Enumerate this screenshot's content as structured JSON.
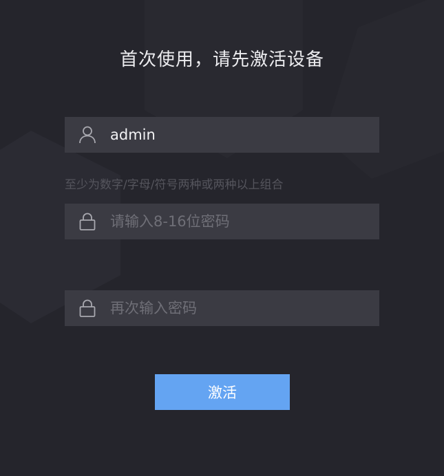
{
  "title": "首次使用，请先激活设备",
  "username": {
    "value": "admin",
    "icon": "user-icon"
  },
  "password_hint": "至少为数字/字母/符号两种或两种以上组合",
  "password": {
    "placeholder": "请输入8-16位密码",
    "value": "",
    "icon": "lock-icon"
  },
  "confirm_password": {
    "placeholder": "再次输入密码",
    "value": "",
    "icon": "lock-icon"
  },
  "activate_label": "激活",
  "colors": {
    "background": "#25252c",
    "field": "#3b3b43",
    "accent": "#64a4f2"
  }
}
